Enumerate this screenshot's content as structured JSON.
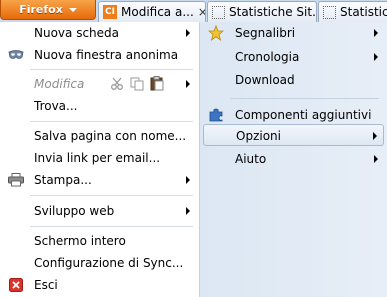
{
  "topbar": {
    "app_button": "Firefox",
    "tabs": [
      {
        "icon": "CI",
        "title": "Modifica a...",
        "close": "×"
      },
      {
        "icon": "",
        "title": "Statistiche Sit...",
        "close": "×"
      },
      {
        "icon": "",
        "title": "Statisticl"
      }
    ]
  },
  "left_menu": {
    "nuova_scheda": "Nuova scheda",
    "nuova_finestra_anonima": "Nuova finestra anonima",
    "modifica": "Modifica",
    "trova": "Trova...",
    "salva_pagina": "Salva pagina con nome...",
    "invia_link": "Invia link per email...",
    "stampa": "Stampa...",
    "sviluppo_web": "Sviluppo web",
    "schermo_intero": "Schermo intero",
    "configurazione_sync": "Configurazione di Sync...",
    "esci": "Esci"
  },
  "right_menu": {
    "segnalibri": "Segnalibri",
    "cronologia": "Cronologia",
    "download": "Download",
    "componenti_aggiuntivi": "Componenti aggiuntivi",
    "opzioni": "Opzioni",
    "aiuto": "Aiuto"
  },
  "colors": {
    "firefox_button": "#e66a0a",
    "highlight_border": "#a9bbd2",
    "exit_icon": "#d9342b"
  }
}
